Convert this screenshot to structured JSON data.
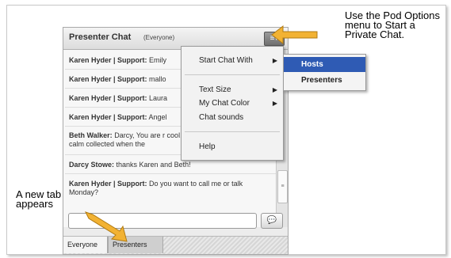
{
  "callouts": {
    "top": "Use the Pod Options menu to Start a Private Chat.",
    "left": "A new tab appears"
  },
  "pod": {
    "title": "Presenter Chat",
    "scope": "(Everyone)",
    "options_icon": "menu-lines-icon"
  },
  "messages": [
    {
      "sender": "Karen Hyder | Support:",
      "text": " Emily"
    },
    {
      "sender": "Karen Hyder | Support:",
      "text": " mallo"
    },
    {
      "sender": "Karen Hyder | Support:",
      "text": " Laura"
    },
    {
      "sender": "Karen Hyder | Support:",
      "text": " Angel"
    },
    {
      "sender": "Beth Walker:",
      "text": " Darcy, You are r cool, calm collected when the"
    },
    {
      "sender": "Darcy Stowe:",
      "text": " thanks Karen and Beth!"
    },
    {
      "sender": "Karen Hyder | Support:",
      "text": " Do you want to call me or talk Monday?"
    }
  ],
  "menu": {
    "start_chat_with": "Start Chat With",
    "text_size": "Text Size",
    "my_chat_color": "My Chat Color",
    "chat_sounds": "Chat sounds",
    "help": "Help"
  },
  "submenu": {
    "hosts": "Hosts",
    "presenters": "Presenters"
  },
  "tabs": {
    "everyone": "Everyone",
    "presenters": "Presenters"
  },
  "send_icon": "speech-bubble-icon",
  "colors": {
    "highlight": "#2f5bb4",
    "arrow": "#f2b233"
  }
}
